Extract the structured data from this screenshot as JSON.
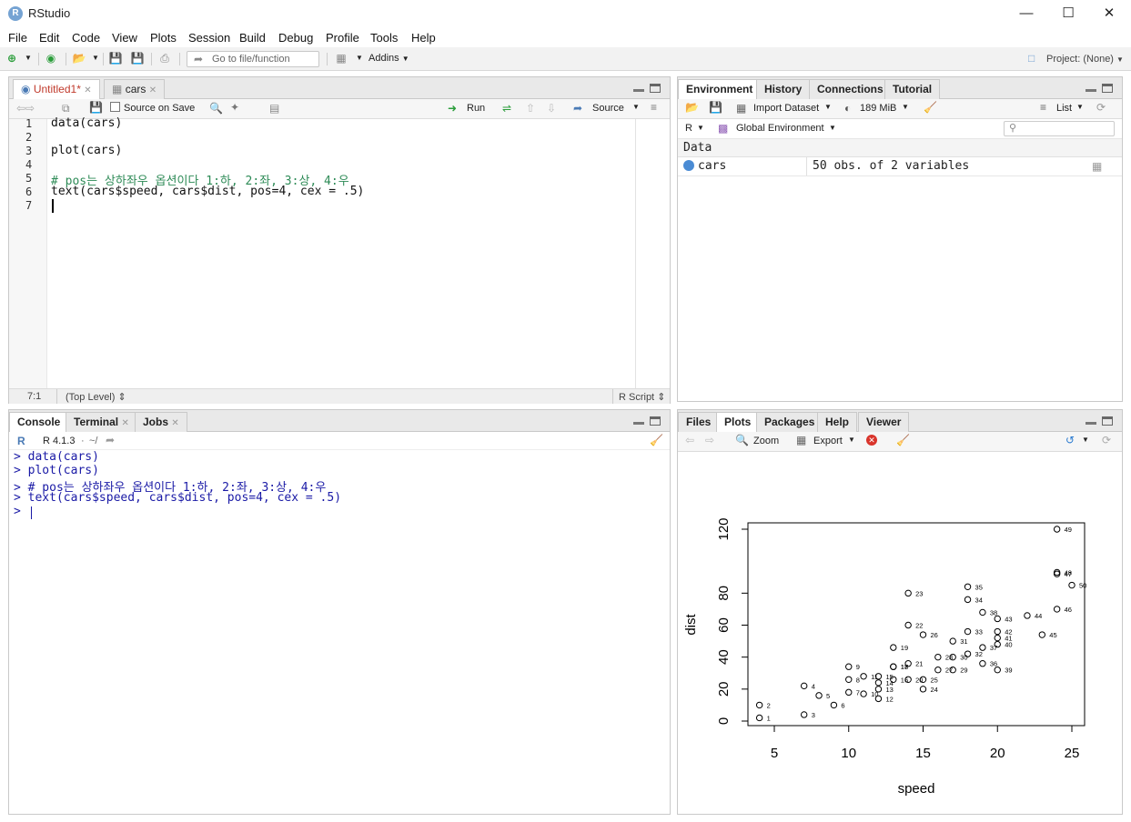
{
  "app": {
    "title": "RStudio"
  },
  "menu": [
    "File",
    "Edit",
    "Code",
    "View",
    "Plots",
    "Session",
    "Build",
    "Debug",
    "Profile",
    "Tools",
    "Help"
  ],
  "toolbar": {
    "goto_placeholder": "Go to file/function",
    "addins": "Addins",
    "project": "Project: (None)"
  },
  "editor": {
    "tabs": [
      {
        "label": "Untitled1*"
      },
      {
        "label": "cars"
      }
    ],
    "source_on_save": "Source on Save",
    "run": "Run",
    "source": "Source",
    "line_numbers": [
      "1",
      "2",
      "3",
      "4",
      "5",
      "6",
      "7"
    ],
    "lines": [
      "data(cars)",
      "",
      "plot(cars)",
      "",
      "# pos는 상하좌우 옵션이다 1:하, 2:좌, 3:상, 4:우",
      "text(cars$speed, cars$dist, pos=4, cex = .5)",
      ""
    ],
    "status": {
      "position": "7:1",
      "scope": "(Top Level)",
      "filetype": "R Script"
    }
  },
  "environment": {
    "tabs": [
      "Environment",
      "History",
      "Connections",
      "Tutorial"
    ],
    "import_dataset": "Import Dataset",
    "memory": "189 MiB",
    "view_mode": "List",
    "language": "R",
    "scope": "Global Environment",
    "section": "Data",
    "rows": [
      {
        "name": "cars",
        "value": "50 obs. of 2 variables"
      }
    ]
  },
  "console": {
    "tabs": [
      "Console",
      "Terminal",
      "Jobs"
    ],
    "version": "R 4.1.3",
    "path": "~/",
    "lines": [
      "> data(cars)",
      "> plot(cars)",
      "> # pos는 상하좌우 옵션이다 1:하, 2:좌, 3:상, 4:우",
      "> text(cars$speed, cars$dist, pos=4, cex = .5)",
      "> "
    ]
  },
  "files_pane": {
    "tabs": [
      "Files",
      "Plots",
      "Packages",
      "Help",
      "Viewer"
    ],
    "zoom": "Zoom",
    "export": "Export"
  },
  "chart_data": {
    "type": "scatter",
    "xlabel": "speed",
    "ylabel": "dist",
    "xticks": [
      5,
      10,
      15,
      20,
      25
    ],
    "yticks": [
      0,
      20,
      40,
      60,
      80,
      120
    ],
    "xlim": [
      4,
      25
    ],
    "ylim": [
      2,
      120
    ],
    "point_labels": [
      "1",
      "2",
      "3",
      "4",
      "5",
      "6",
      "7",
      "8",
      "9",
      "10",
      "11",
      "12",
      "13",
      "14",
      "15",
      "16",
      "17",
      "18",
      "19",
      "20",
      "21",
      "22",
      "23",
      "24",
      "25",
      "26",
      "27",
      "28",
      "29",
      "30",
      "31",
      "32",
      "33",
      "34",
      "35",
      "36",
      "37",
      "38",
      "39",
      "40",
      "41",
      "42",
      "43",
      "44",
      "45",
      "46",
      "47",
      "48",
      "49",
      "50"
    ],
    "x": [
      4,
      4,
      7,
      7,
      8,
      9,
      10,
      10,
      10,
      11,
      11,
      12,
      12,
      12,
      12,
      13,
      13,
      13,
      13,
      14,
      14,
      14,
      14,
      15,
      15,
      15,
      16,
      16,
      17,
      17,
      17,
      18,
      18,
      18,
      18,
      19,
      19,
      19,
      20,
      20,
      20,
      20,
      20,
      22,
      23,
      24,
      24,
      24,
      24,
      25
    ],
    "y": [
      2,
      10,
      4,
      22,
      16,
      10,
      18,
      26,
      34,
      17,
      28,
      14,
      20,
      24,
      28,
      26,
      34,
      34,
      46,
      26,
      36,
      60,
      80,
      20,
      26,
      54,
      32,
      40,
      32,
      40,
      50,
      42,
      56,
      76,
      84,
      36,
      46,
      68,
      32,
      48,
      52,
      56,
      64,
      66,
      54,
      70,
      92,
      93,
      120,
      85
    ]
  }
}
